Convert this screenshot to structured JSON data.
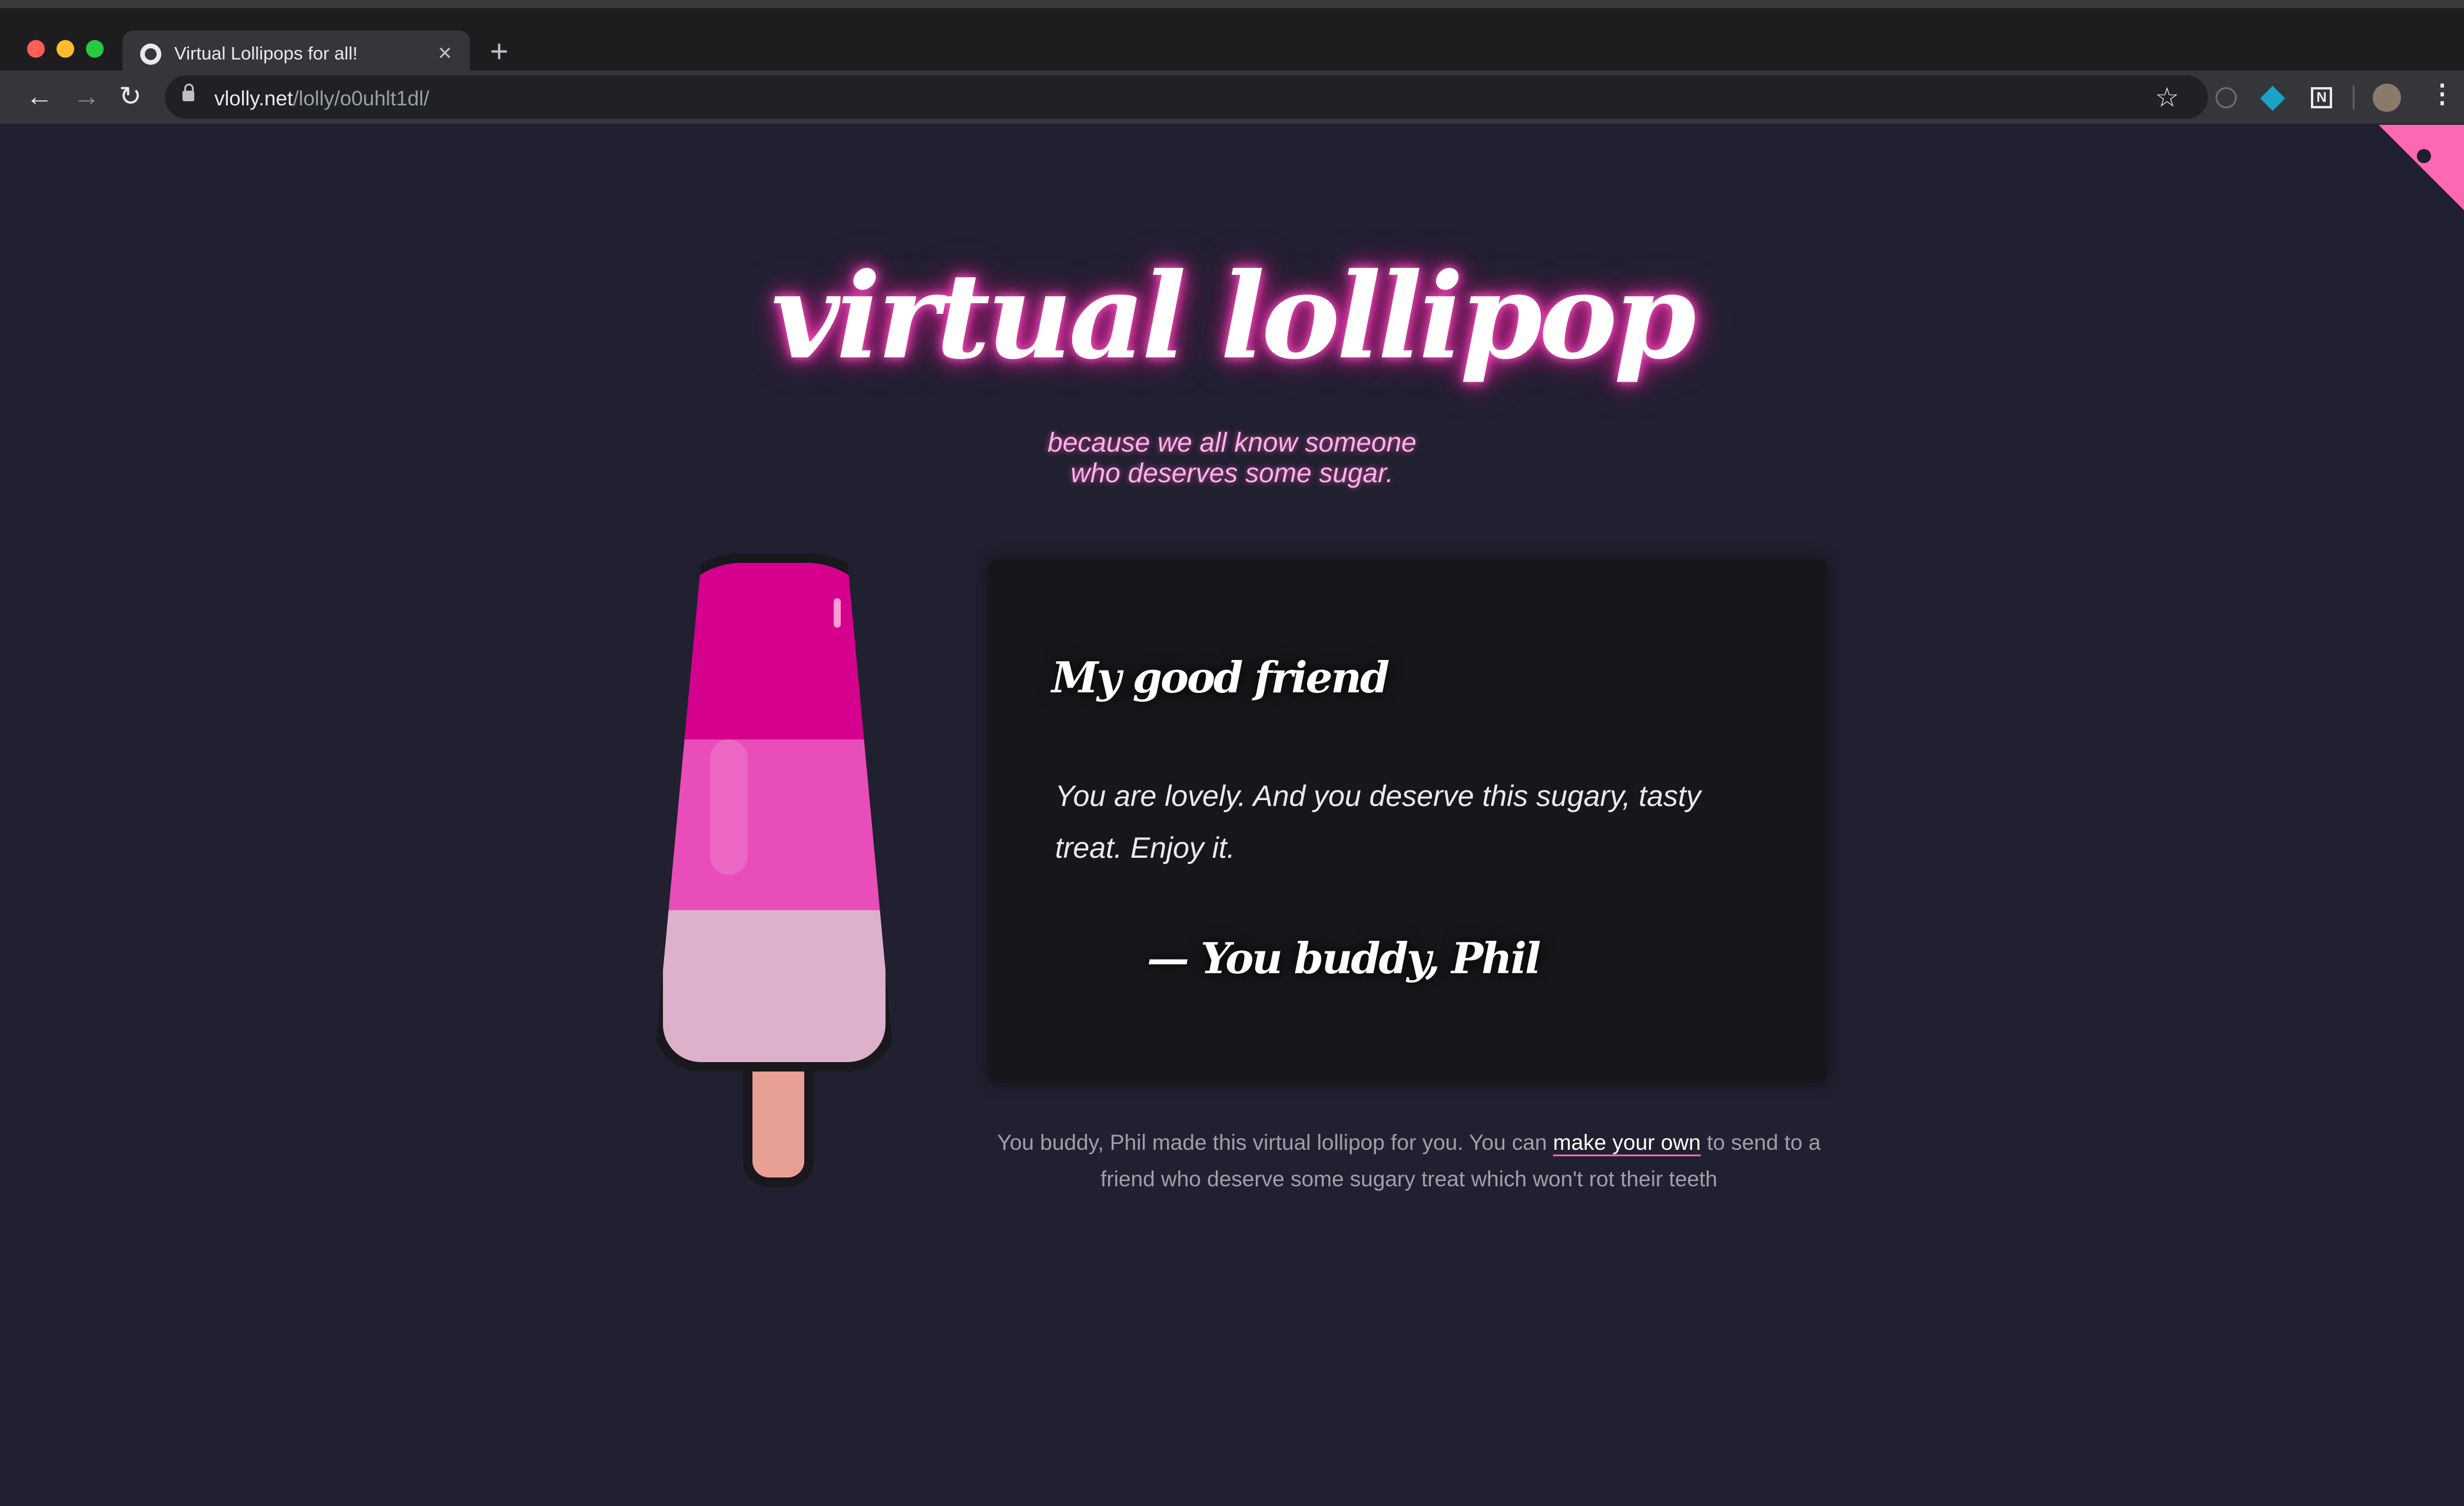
{
  "browser": {
    "tab_title": "Virtual Lollipops for all!",
    "tab_close_label": "×",
    "new_tab_label": "+",
    "url_host": "vlolly.net",
    "url_path": "/lolly/o0uhlt1dl/"
  },
  "page": {
    "headline": "virtual lollipop",
    "tagline_line1": "because we all know someone",
    "tagline_line2": "who deserves some sugar."
  },
  "lolly": {
    "colors": {
      "top": "#d5008e",
      "middle": "#e84db9",
      "bottom": "#ddb0cc",
      "stick": "#e8a095"
    }
  },
  "card": {
    "recipient": "My good friend",
    "message": "You are lovely. And you deserve this sugary, tasty treat. Enjoy it.",
    "from": "— You buddy, Phil"
  },
  "footer": {
    "text_before": "You buddy, Phil made this virtual lollipop for you. You can ",
    "link": "make your own",
    "text_after": " to send to a friend who deserve some sugary treat which won't rot their teeth"
  },
  "colors": {
    "background": "#202030",
    "accent": "#ff69b4"
  }
}
